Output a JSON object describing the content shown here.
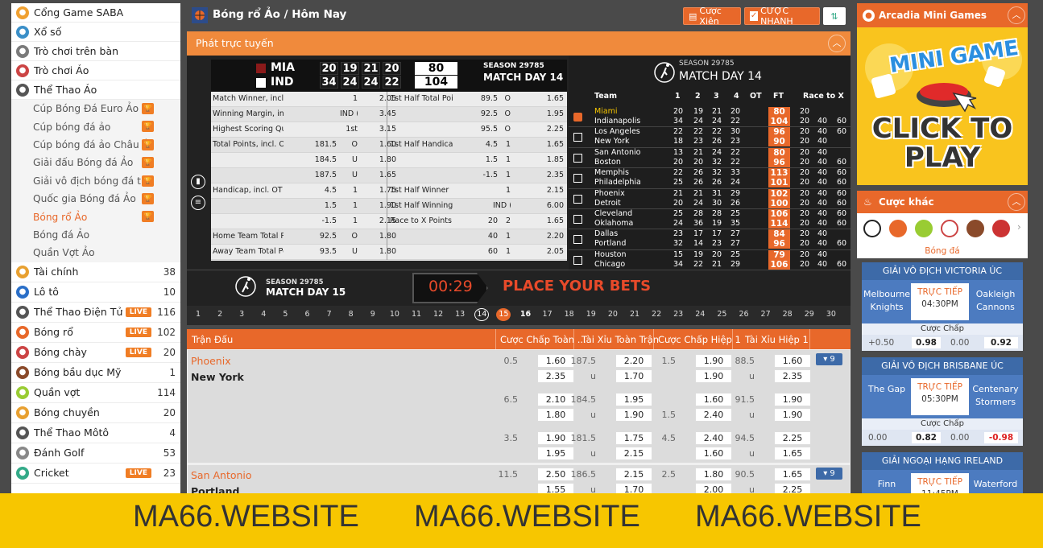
{
  "sidebar": {
    "top": [
      {
        "label": "Cổng Game SABA",
        "icon": "saba-icon",
        "color": "#f0a030"
      },
      {
        "label": "Xổ số",
        "icon": "lottery-icon",
        "color": "#3a8fc8"
      },
      {
        "label": "Trò chơi trên bàn",
        "icon": "table-game-icon",
        "color": "#7a7a7a"
      },
      {
        "label": "Trò chơi Ảo",
        "icon": "virtual-game-icon",
        "color": "#c44"
      },
      {
        "label": "Thể Thao Ảo",
        "icon": "virtual-sports-icon",
        "color": "#555"
      }
    ],
    "sub": [
      {
        "label": "Cúp Bóng Đá Euro Ảo"
      },
      {
        "label": "Cúp bóng đá ảo"
      },
      {
        "label": "Cúp bóng đá ảo Châu Á"
      },
      {
        "label": "Giải đấu Bóng đá Ảo"
      },
      {
        "label": "Giải vô địch bóng đá t..."
      },
      {
        "label": "Quốc gia Bóng đá Ảo"
      },
      {
        "label": "Bóng rổ Ảo"
      },
      {
        "label": "Bóng đá Ảo"
      },
      {
        "label": "Quần Vợt Ảo"
      }
    ],
    "sports": [
      {
        "label": "Tài chính",
        "count": "38",
        "live": "",
        "color": "#e8a030"
      },
      {
        "label": "Lô tô",
        "count": "10",
        "live": "",
        "color": "#2a6fc8"
      },
      {
        "label": "Thể Thao Điện Tử",
        "count": "116",
        "live": "LIVE",
        "color": "#555"
      },
      {
        "label": "Bóng rổ",
        "count": "102",
        "live": "LIVE",
        "color": "#e8682a"
      },
      {
        "label": "Bóng chày",
        "count": "20",
        "live": "LIVE",
        "color": "#c44"
      },
      {
        "label": "Bóng bầu dục Mỹ",
        "count": "1",
        "live": "",
        "color": "#8a4a2a"
      },
      {
        "label": "Quần vợt",
        "count": "114",
        "live": "",
        "color": "#9c3"
      },
      {
        "label": "Bóng chuyền",
        "count": "20",
        "live": "",
        "color": "#e8a030"
      },
      {
        "label": "Thể Thao Môtô",
        "count": "4",
        "live": "",
        "color": "#555"
      },
      {
        "label": "Đánh Golf",
        "count": "53",
        "live": "",
        "color": "#888"
      },
      {
        "label": "Cricket",
        "count": "23",
        "live": "LIVE",
        "color": "#3a8"
      }
    ]
  },
  "header": {
    "breadcrumb": "Bóng rổ Ảo / Hôm Nay",
    "btn_parlay": "Cược Xiên",
    "btn_quick": "CƯỢC NHANH"
  },
  "live": {
    "title": "Phát trực tuyến",
    "teamA": "MIA",
    "teamB": "IND",
    "quartersA": [
      "20",
      "19",
      "21",
      "20"
    ],
    "totalA": "80",
    "quartersB": [
      "34",
      "24",
      "24",
      "22"
    ],
    "totalB": "104",
    "season": "SEASON 29785",
    "matchday": "MATCH DAY 14",
    "odds": [
      [
        "Match Winner, incl. OT",
        "",
        "1",
        "2.05",
        "1st Half Total Points",
        "89.5",
        "O",
        "1.65"
      ],
      [
        "Winning Margin, incl....",
        "",
        "IND (...",
        "3.45",
        "",
        "92.5",
        "O",
        "1.95"
      ],
      [
        "Highest Scoring Qua...",
        "",
        "1st",
        "3.15",
        "",
        "95.5",
        "O",
        "2.25"
      ],
      [
        "Total Points, incl. OT",
        "181.5",
        "O",
        "1.60",
        "1st Half Handicap",
        "4.5",
        "1",
        "1.65"
      ],
      [
        "",
        "184.5",
        "U",
        "1.80",
        "",
        "1.5",
        "1",
        "1.85"
      ],
      [
        "",
        "187.5",
        "U",
        "1.65",
        "",
        "-1.5",
        "1",
        "2.35"
      ],
      [
        "Handicap, incl. OT",
        "4.5",
        "1",
        "1.75",
        "1st Half Winner",
        "",
        "1",
        "2.15"
      ],
      [
        "",
        "1.5",
        "1",
        "1.90",
        "1st Half Winning Mar...",
        "",
        "IND (...",
        "6.00"
      ],
      [
        "",
        "-1.5",
        "1",
        "2.15",
        "Race to X Points",
        "20",
        "2",
        "1.65"
      ],
      [
        "Home Team Total Po...",
        "92.5",
        "O",
        "1.80",
        "",
        "40",
        "1",
        "2.20"
      ],
      [
        "Away Team Total Poi...",
        "93.5",
        "U",
        "1.80",
        "",
        "60",
        "1",
        "2.05"
      ]
    ]
  },
  "standings": {
    "season": "SEASON 29785",
    "matchday": "MATCH DAY 14",
    "headers": [
      "Team",
      "1",
      "2",
      "3",
      "4",
      "OT",
      "FT",
      "Race to X"
    ],
    "rows": [
      {
        "t1": "Miami",
        "t2": "Indianapolis",
        "a": [
          "20",
          "19",
          "21",
          "20"
        ],
        "b": [
          "34",
          "24",
          "24",
          "22"
        ],
        "fa": "80",
        "fb": "104",
        "ra": [
          "20",
          "",
          ""
        ],
        "rb": [
          "20",
          "40",
          "60"
        ]
      },
      {
        "t1": "Los Angeles",
        "t2": "New York",
        "a": [
          "22",
          "22",
          "22",
          "30"
        ],
        "b": [
          "18",
          "23",
          "26",
          "23"
        ],
        "fa": "96",
        "fb": "90",
        "ra": [
          "20",
          "40",
          "60"
        ],
        "rb": [
          "20",
          "40",
          ""
        ]
      },
      {
        "t1": "San Antonio",
        "t2": "Boston",
        "a": [
          "13",
          "21",
          "24",
          "22"
        ],
        "b": [
          "20",
          "20",
          "32",
          "22"
        ],
        "fa": "80",
        "fb": "96",
        "ra": [
          "20",
          "40",
          ""
        ],
        "rb": [
          "20",
          "40",
          "60"
        ]
      },
      {
        "t1": "Memphis",
        "t2": "Philadelphia",
        "a": [
          "22",
          "26",
          "32",
          "33"
        ],
        "b": [
          "25",
          "26",
          "26",
          "24"
        ],
        "fa": "113",
        "fb": "101",
        "ra": [
          "20",
          "40",
          "60"
        ],
        "rb": [
          "20",
          "40",
          "60"
        ]
      },
      {
        "t1": "Phoenix",
        "t2": "Detroit",
        "a": [
          "21",
          "21",
          "31",
          "29"
        ],
        "b": [
          "20",
          "24",
          "30",
          "26"
        ],
        "fa": "102",
        "fb": "100",
        "ra": [
          "20",
          "40",
          "60"
        ],
        "rb": [
          "20",
          "40",
          "60"
        ]
      },
      {
        "t1": "Cleveland",
        "t2": "Oklahoma",
        "a": [
          "25",
          "28",
          "28",
          "25"
        ],
        "b": [
          "24",
          "36",
          "19",
          "35"
        ],
        "fa": "106",
        "fb": "114",
        "ra": [
          "20",
          "40",
          "60"
        ],
        "rb": [
          "20",
          "40",
          "60"
        ]
      },
      {
        "t1": "Dallas",
        "t2": "Portland",
        "a": [
          "23",
          "17",
          "17",
          "27"
        ],
        "b": [
          "32",
          "14",
          "23",
          "27"
        ],
        "fa": "84",
        "fb": "96",
        "ra": [
          "20",
          "40",
          ""
        ],
        "rb": [
          "20",
          "40",
          "60"
        ]
      },
      {
        "t1": "Houston",
        "t2": "Chicago",
        "a": [
          "15",
          "19",
          "20",
          "25"
        ],
        "b": [
          "34",
          "22",
          "21",
          "29"
        ],
        "fa": "79",
        "fb": "106",
        "ra": [
          "20",
          "40",
          ""
        ],
        "rb": [
          "20",
          "40",
          "60"
        ]
      }
    ]
  },
  "countdown": {
    "season": "SEASON 29785",
    "matchday": "MATCH DAY 15",
    "timer": "00:29",
    "cta": "PLACE YOUR BETS"
  },
  "days": [
    "1",
    "2",
    "3",
    "4",
    "5",
    "6",
    "7",
    "8",
    "9",
    "10",
    "11",
    "12",
    "13",
    "14",
    "15",
    "16",
    "17",
    "18",
    "19",
    "20",
    "21",
    "22",
    "23",
    "24",
    "25",
    "26",
    "27",
    "28",
    "29",
    "30"
  ],
  "matches": {
    "headers": [
      "Trận Đấu",
      "Cược Chấp Toàn ...",
      "Tài Xỉu Toàn Trận",
      "Cược Chấp Hiệp 1",
      "Tài Xỉu Hiệp 1"
    ],
    "m1": {
      "home": "Phoenix",
      "away": "New York",
      "more": "▾ 9",
      "lines": [
        [
          "0.5",
          "1.60",
          "",
          "2.35",
          "187.5",
          "2.20",
          "u",
          "1.70",
          "1.5",
          "1.90",
          "",
          "1.90",
          "88.5",
          "1.60",
          "u",
          "2.35"
        ],
        [
          "6.5",
          "2.10",
          "",
          "1.80",
          "184.5",
          "1.95",
          "u",
          "1.90",
          "",
          "1.60",
          "1.5",
          "2.40",
          "91.5",
          "1.90",
          "u",
          "1.90"
        ],
        [
          "3.5",
          "1.90",
          "",
          "1.95",
          "181.5",
          "1.75",
          "u",
          "2.15",
          "4.5",
          "2.40",
          "",
          "1.60",
          "94.5",
          "2.25",
          "u",
          "1.65"
        ]
      ]
    },
    "m2": {
      "home": "San Antonio",
      "away": "Portland",
      "more": "▾ 9",
      "line": [
        "11.5",
        "2.50",
        "",
        "1.55",
        "186.5",
        "2.15",
        "u",
        "1.70",
        "2.5",
        "1.80",
        "",
        "2.00",
        "90.5",
        "1.65",
        "u",
        "2.25"
      ]
    }
  },
  "right": {
    "mini_title": "Arcadia Mini Games",
    "banner_top": "MINI GAME",
    "banner_bottom": "CLICK TO PLAY",
    "other_title": "Cược khác",
    "sport_label": "Bóng đá",
    "cards": [
      {
        "league": "GIẢI VÔ ĐỊCH VICTORIA ÚC",
        "t1": "Melbourne Knights",
        "t2": "Oakleigh Cannons",
        "live": "TRỰC TIẾP",
        "time": "04:30PM",
        "label": "Cược Chấp",
        "h1": "+0.50",
        "o1": "0.98",
        "h2": "0.00",
        "o2": "0.92"
      },
      {
        "league": "GIẢI VÔ ĐỊCH BRISBANE ÚC",
        "t1": "The Gap",
        "t2": "Centenary Stormers",
        "live": "TRỰC TIẾP",
        "time": "05:30PM",
        "label": "Cược Chấp",
        "h1": "0.00",
        "o1": "0.82",
        "h2": "0.00",
        "o2": "-0.98"
      },
      {
        "league": "GIẢI NGOẠI HẠNG IRELAND",
        "t1": "Finn Harps",
        "t2": "Waterford FC",
        "live": "TRỰC TIẾP",
        "time": "11:45PM"
      }
    ]
  },
  "footer": [
    "MA66.WEBSITE",
    "MA66.WEBSITE",
    "MA66.WEBSITE"
  ],
  "colors": {
    "accent": "#e8682a",
    "brand": "#f7c600",
    "blue": "#3d6aa8"
  }
}
